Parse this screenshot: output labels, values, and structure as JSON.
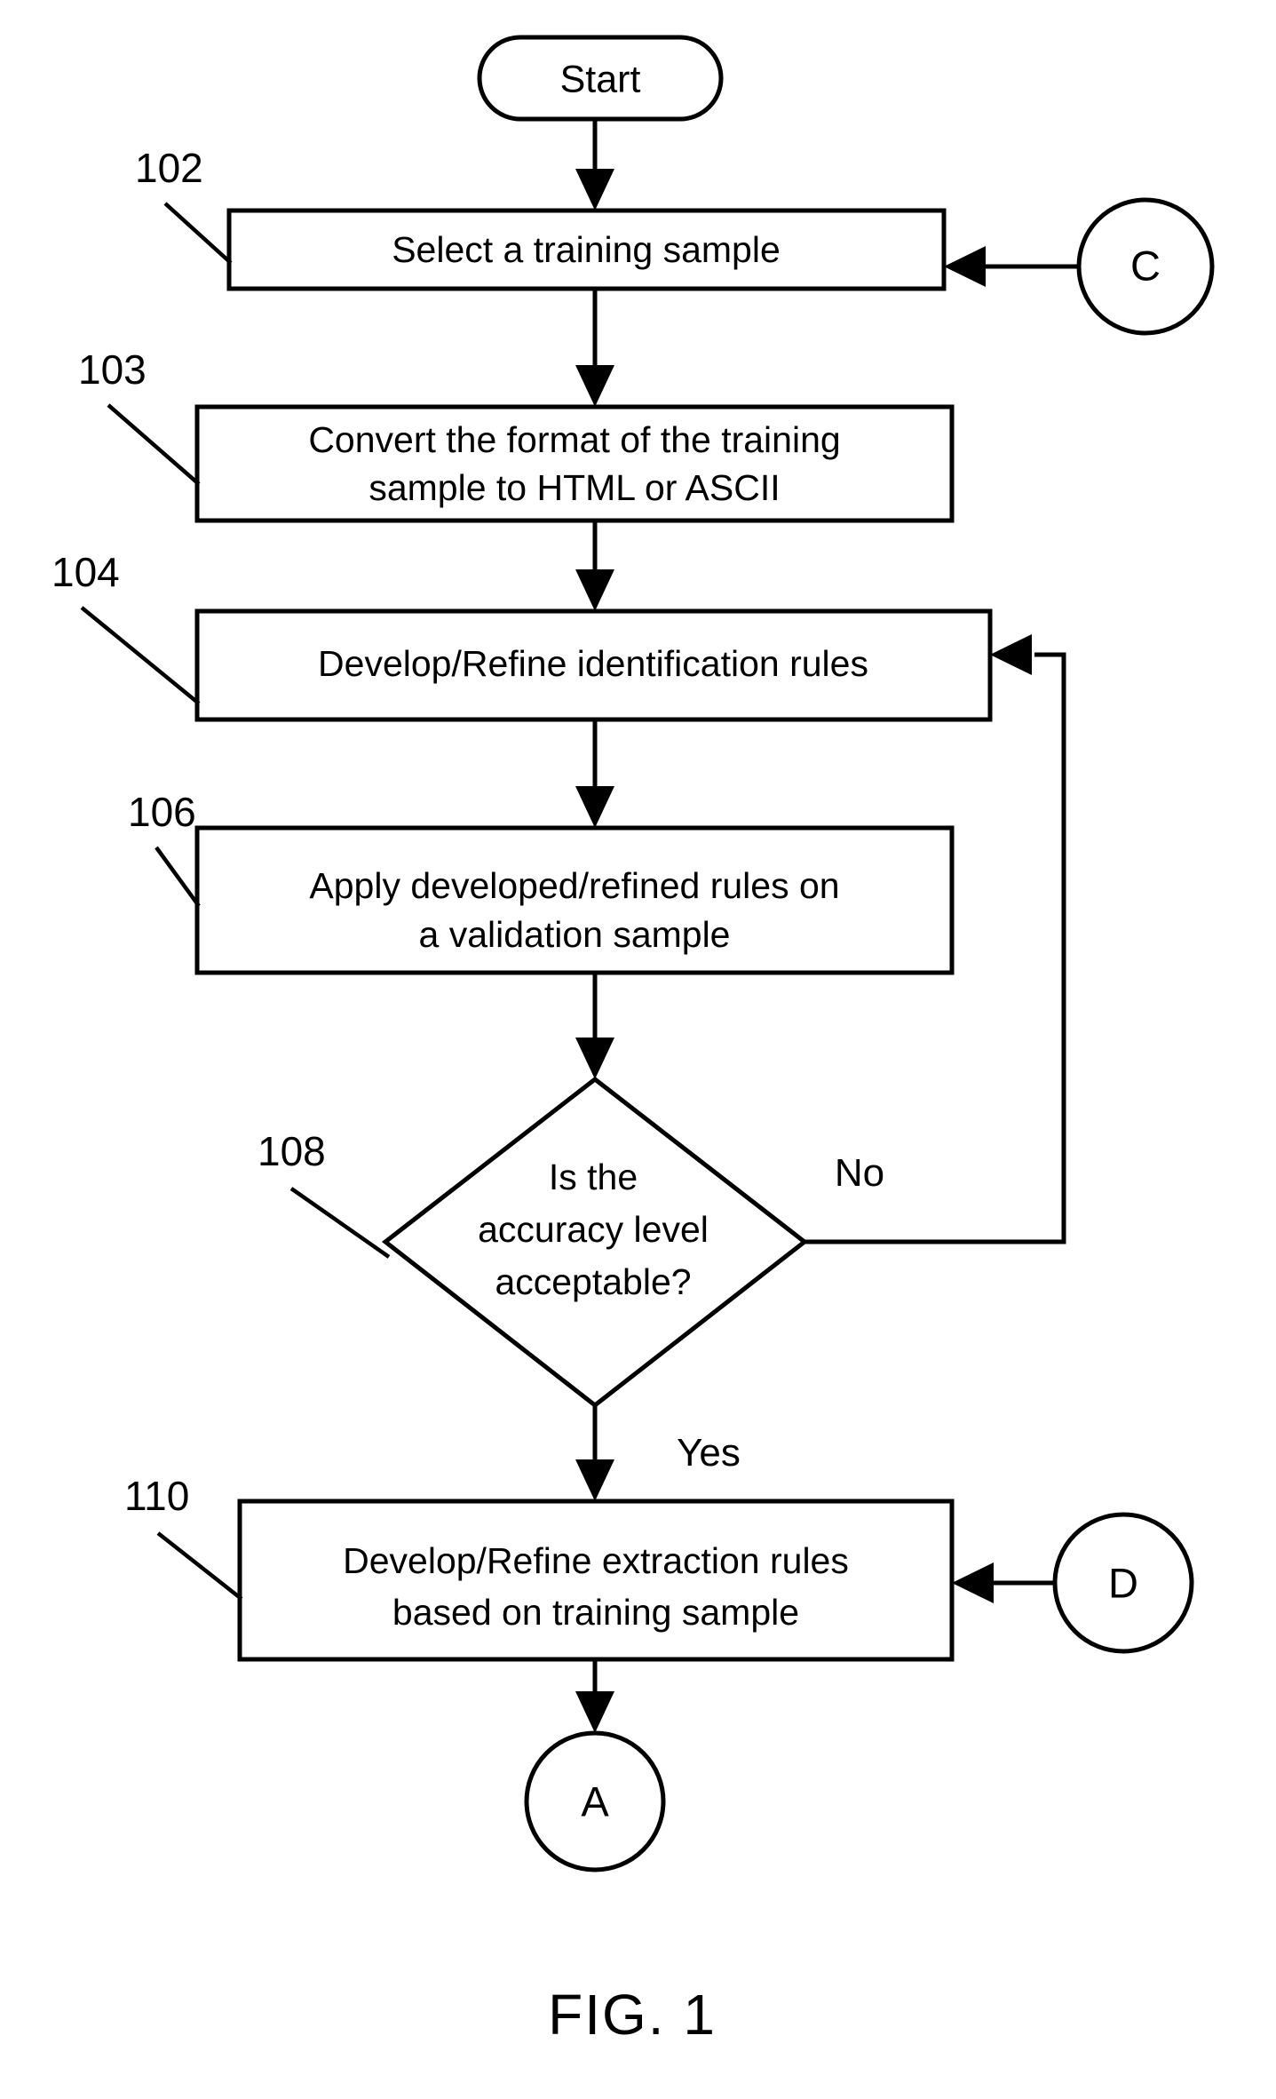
{
  "figure": {
    "caption": "FIG. 1",
    "type": "flowchart"
  },
  "nodes": {
    "start": {
      "label": "Start",
      "shape": "stadium"
    },
    "step_102": {
      "ref": "102",
      "label": "Select a training sample",
      "shape": "process"
    },
    "step_103": {
      "ref": "103",
      "line1": "Convert the format of the training",
      "line2": "sample to HTML or ASCII",
      "shape": "process"
    },
    "step_104": {
      "ref": "104",
      "label": "Develop/Refine identification rules",
      "shape": "process"
    },
    "step_106": {
      "ref": "106",
      "line1": "Apply developed/refined rules on",
      "line2": "a validation sample",
      "shape": "process"
    },
    "decision_108": {
      "ref": "108",
      "line1": "Is the",
      "line2": "accuracy level",
      "line3": "acceptable?",
      "shape": "diamond"
    },
    "step_110": {
      "ref": "110",
      "line1": "Develop/Refine extraction rules",
      "line2": "based on training sample",
      "shape": "process"
    },
    "connector_a": {
      "label": "A",
      "shape": "circle"
    },
    "connector_c": {
      "label": "C",
      "shape": "circle"
    },
    "connector_d": {
      "label": "D",
      "shape": "circle"
    }
  },
  "edges": {
    "no_branch_label": "No",
    "yes_branch_label": "Yes"
  },
  "colors": {
    "stroke": "#000000",
    "fill": "#ffffff",
    "text": "#000000"
  }
}
